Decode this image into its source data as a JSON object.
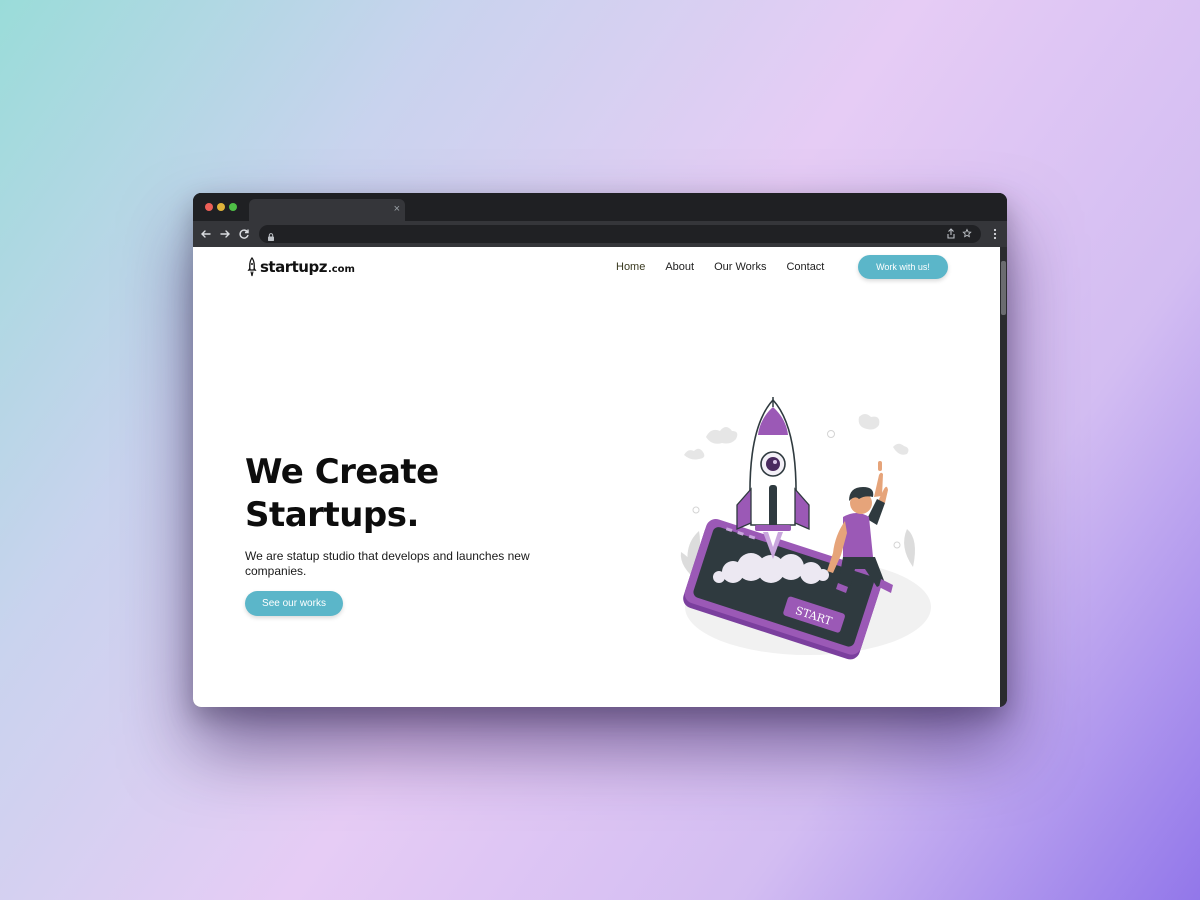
{
  "browser": {
    "tab_close": "×",
    "url": ""
  },
  "site": {
    "logo_main": "startupz",
    "logo_suffix": ".com",
    "nav": [
      {
        "label": "Home"
      },
      {
        "label": "About"
      },
      {
        "label": "Our Works"
      },
      {
        "label": "Contact"
      }
    ],
    "nav_cta": "Work with us!"
  },
  "hero": {
    "title_line1": "We Create",
    "title_line2": "Startups.",
    "subtitle": "We are statup studio that develops and launches new companies.",
    "cta": "See our works",
    "illustration_button_label": "START"
  },
  "colors": {
    "accent": "#5bb6c9",
    "illustration_purple": "#9b59b6",
    "text": "#0d0d0d"
  }
}
